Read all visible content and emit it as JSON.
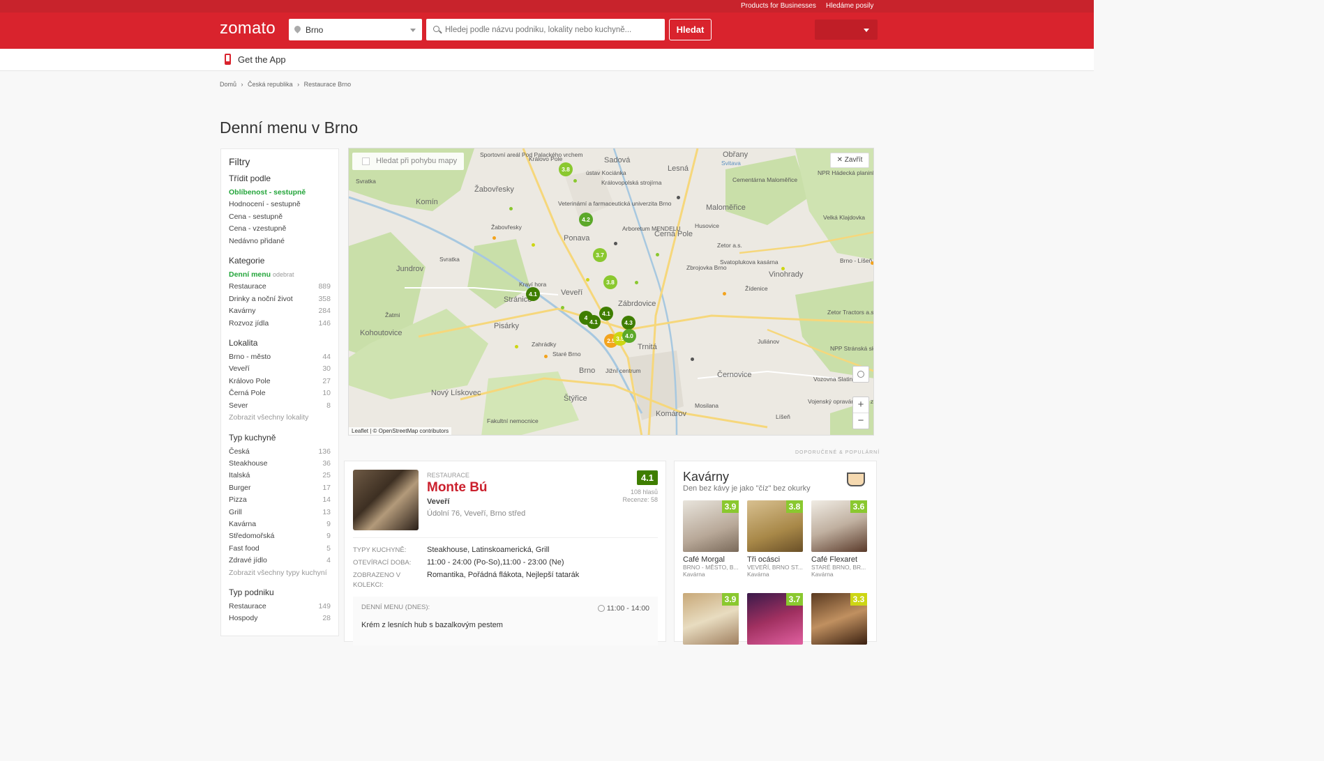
{
  "topbar": {
    "link1": "Products for Businesses",
    "link2": "Hledáme posily"
  },
  "header": {
    "logo": "zomato",
    "location": "Brno",
    "search_placeholder": "Hledej podle názvu podniku, lokality nebo kuchyně...",
    "search_button": "Hledat"
  },
  "appbar": {
    "label": "Get the App"
  },
  "breadcrumb": [
    "Domů",
    "›",
    "Česká republika",
    "›",
    "Restaurace Brno"
  ],
  "page_title": "Denní menu v Brno",
  "filters": {
    "title": "Filtry",
    "sort": {
      "heading": "Třídit podle",
      "active": "Oblíbenost",
      "active_sub": " - sestupně",
      "items": [
        "Hodnocení - sestupně",
        "Cena - sestupně",
        "Cena - vzestupně",
        "Nedávno přidané"
      ]
    },
    "category": {
      "heading": "Kategorie",
      "active": "Denní menu",
      "active_sub": "odebrat",
      "items": [
        {
          "label": "Restaurace",
          "count": "889"
        },
        {
          "label": "Drinky a noční život",
          "count": "358"
        },
        {
          "label": "Kavárny",
          "count": "284"
        },
        {
          "label": "Rozvoz jídla",
          "count": "146"
        }
      ]
    },
    "locality": {
      "heading": "Lokalita",
      "items": [
        {
          "label": "Brno - město",
          "count": "44"
        },
        {
          "label": "Veveří",
          "count": "30"
        },
        {
          "label": "Královo Pole",
          "count": "27"
        },
        {
          "label": "Černá Pole",
          "count": "10"
        },
        {
          "label": "Sever",
          "count": "8"
        }
      ],
      "more": "Zobrazit všechny lokality"
    },
    "cuisine": {
      "heading": "Typ kuchyně",
      "items": [
        {
          "label": "Česká",
          "count": "136"
        },
        {
          "label": "Steakhouse",
          "count": "36"
        },
        {
          "label": "Italská",
          "count": "25"
        },
        {
          "label": "Burger",
          "count": "17"
        },
        {
          "label": "Pizza",
          "count": "14"
        },
        {
          "label": "Grill",
          "count": "13"
        },
        {
          "label": "Kavárna",
          "count": "9"
        },
        {
          "label": "Středomořská",
          "count": "9"
        },
        {
          "label": "Fast food",
          "count": "5"
        },
        {
          "label": "Zdravé jídlo",
          "count": "4"
        }
      ],
      "more": "Zobrazit všechny typy kuchyní"
    },
    "venue": {
      "heading": "Typ podniku",
      "items": [
        {
          "label": "Restaurace",
          "count": "149"
        },
        {
          "label": "Hospody",
          "count": "28"
        }
      ]
    }
  },
  "map": {
    "search_on_move": "Hledat při pohybu mapy",
    "close": "Zavřít",
    "zoom_in": "+",
    "zoom_out": "−",
    "attribution": "Leaflet | © OpenStreetMap contributors",
    "labels": [
      "Sportovní areál Pod Palackého vrchem",
      "Královo Pole",
      "Sadová",
      "Obřany",
      "Svitava",
      "Lesná",
      "Svratka",
      "Komín",
      "Žabovřesky",
      "ústav Kociánka",
      "Královopolská strojírna",
      "Cementárna Maloměřice",
      "NPR Hádecká planinka",
      "Maloměřice",
      "Veterinární a farmaceutická univerzita Brno",
      "Ponava",
      "Arboretum MENDELU",
      "Černá Pole",
      "Husovice",
      "Zetor a.s.",
      "Velká Klajdovka",
      "Jundrov",
      "Svratka",
      "Kraví hora",
      "Stránice",
      "Veveří",
      "Zábrdovice",
      "Svatoplukova kasárna",
      "Zbrojovka Brno",
      "Vinohrady",
      "Brno - Líšeň",
      "Žídenice",
      "Žabovřesky",
      "Pisárky",
      "Brno",
      "Trnitá",
      "Komárov",
      "Černovice",
      "Mosilana",
      "Štýřice",
      "Kohoutovice",
      "Nový Lískovec",
      "Žatmi",
      "Líšeň",
      "Zahrádky",
      "Staré Brno",
      "Jižní centrum",
      "Vojenský opravárenský závod",
      "Vozovna Slatina",
      "Zetor Tractors a.s.",
      "Juliánov",
      "NPP Stránská skála",
      "Fakultní nemocnice"
    ]
  },
  "map_clusters": [
    {
      "v": "3.8",
      "color": "#8ac82f"
    },
    {
      "v": "4.2",
      "color": "#5ba829"
    },
    {
      "v": "3.7",
      "color": "#8ac82f"
    },
    {
      "v": "3.8",
      "color": "#8ac82f"
    },
    {
      "v": "4.1",
      "color": "#3f7e00"
    },
    {
      "v": "4.1",
      "color": "#3f7e00"
    },
    {
      "v": "4",
      "color": "#3f7e00"
    },
    {
      "v": "4.1",
      "color": "#3f7e00"
    },
    {
      "v": "4.3",
      "color": "#3f7e00"
    },
    {
      "v": "2.5",
      "color": "#f3a31d"
    },
    {
      "v": "3.5",
      "color": "#cdd614"
    },
    {
      "v": "4.0",
      "color": "#5ba829"
    }
  ],
  "section_label": "DOPORUČENÉ & POPULÁRNÍ",
  "restaurant": {
    "type": "RESTAURACE",
    "name": "Monte Bú",
    "locality": "Veveří",
    "address": "Údolní 76, Veveří, Brno střed",
    "rating": "4.1",
    "votes": "108 hlasů",
    "reviews": "Recenze: 58",
    "cuisine_label": "TYPY KUCHYNĚ:",
    "cuisine_value": "Steakhouse, Latinskoamerická, Grill",
    "hours_label": "OTEVÍRACÍ DOBA:",
    "hours_value": "11:00 - 24:00 (Po-So),11:00 - 23:00 (Ne)",
    "collections_label": "ZOBRAZENO V KOLEKCI:",
    "collections_value": "Romantika, Pořádná flákota, Nejlepší tatarák",
    "menu_label": "DENNÍ MENU (DNES):",
    "menu_time": "11:00 - 14:00",
    "menu_item": "Krém z lesních hub s bazalkovým pestem"
  },
  "cafes": {
    "title": "Kavárny",
    "subtitle": "Den bez kávy je jako \"číz\" bez okurky",
    "items": [
      {
        "name": "Café Morgal",
        "loc": "BRNO - MĚSTO, B...",
        "type": "Kavárna",
        "rating": "3.9"
      },
      {
        "name": "Tři ocásci",
        "loc": "VEVEŘÍ, BRNO ST...",
        "type": "Kavárna",
        "rating": "3.8"
      },
      {
        "name": "Café Flexaret",
        "loc": "STARÉ BRNO, BR...",
        "type": "Kavárna",
        "rating": "3.6"
      },
      {
        "name": "",
        "loc": "",
        "type": "",
        "rating": "3.9"
      },
      {
        "name": "",
        "loc": "",
        "type": "",
        "rating": "3.7"
      },
      {
        "name": "",
        "loc": "",
        "type": "",
        "rating": "3.3"
      }
    ]
  }
}
